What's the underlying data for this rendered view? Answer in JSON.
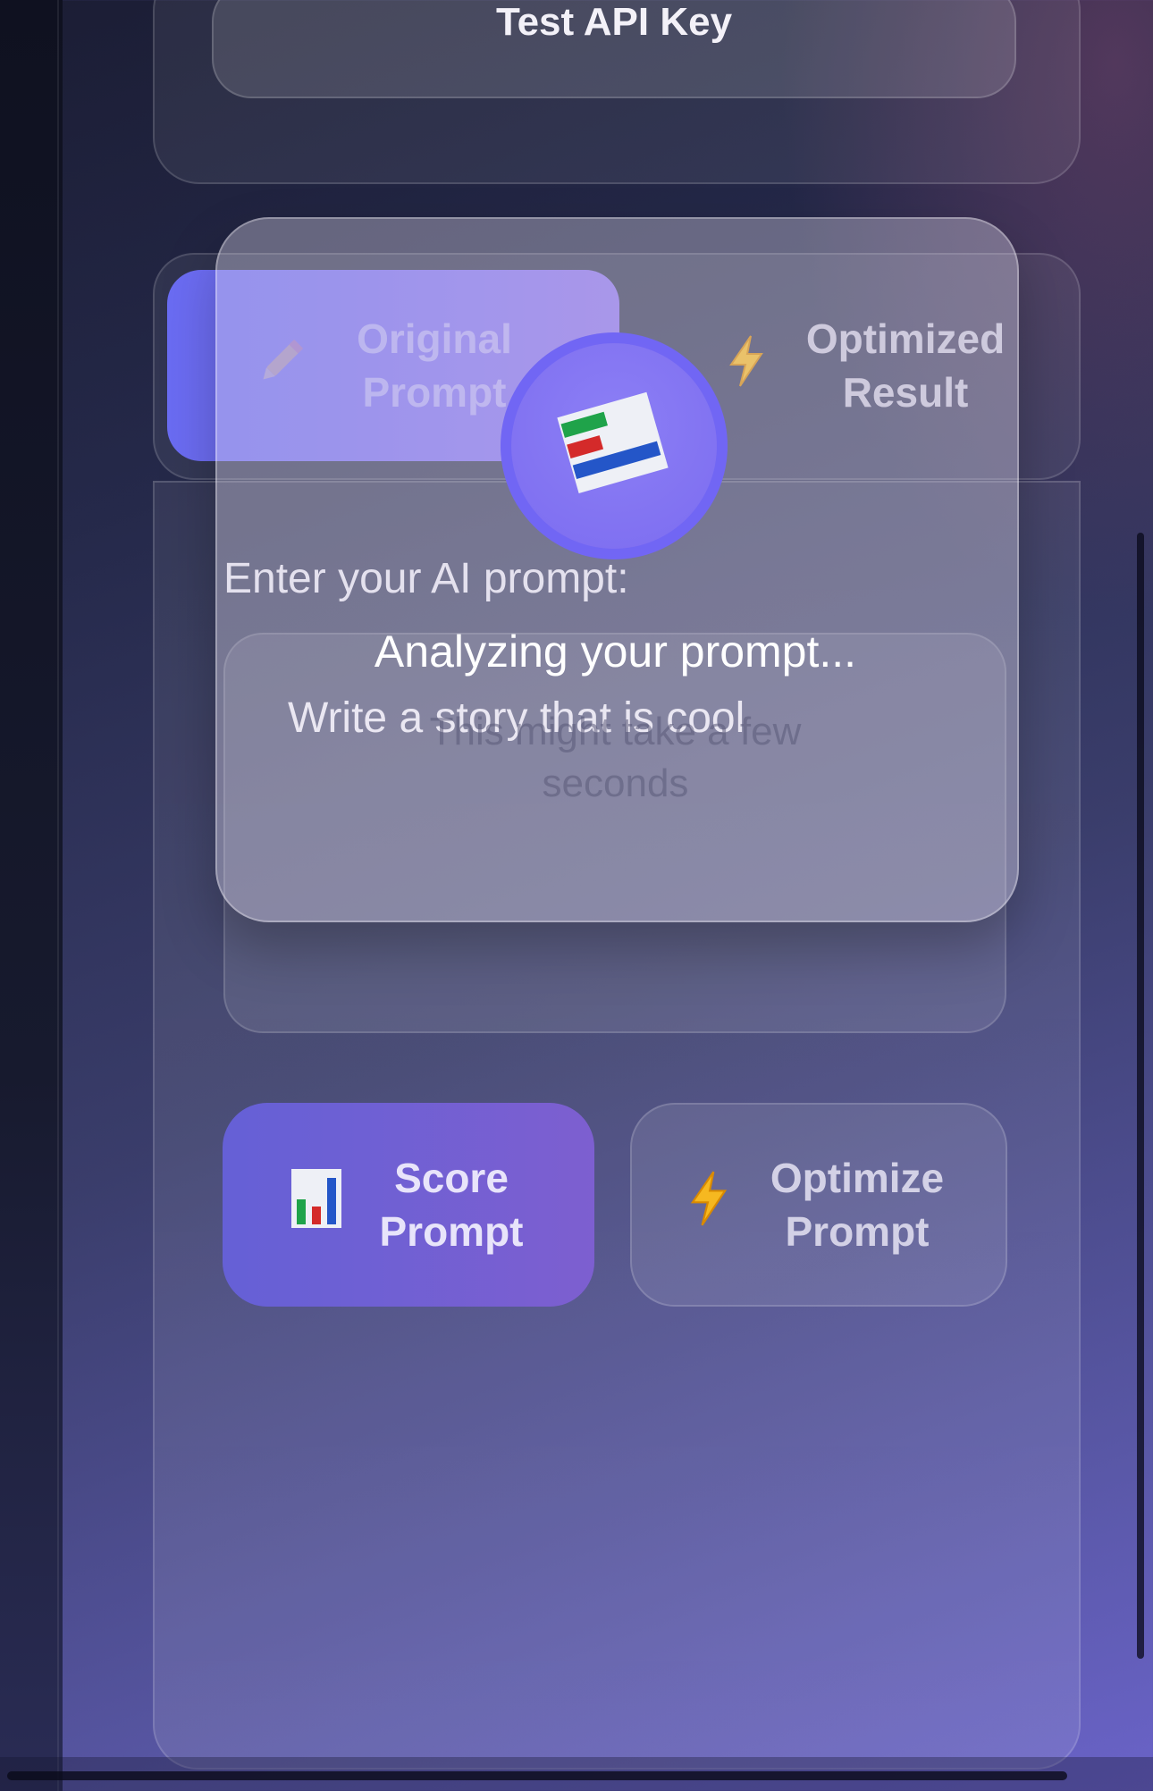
{
  "api": {
    "test_button_label": "Test API Key"
  },
  "tabs": [
    {
      "label": "Original Prompt",
      "icon": "pencil-icon",
      "active": true
    },
    {
      "label": "Optimized Result",
      "icon": "lightning-icon",
      "active": false
    }
  ],
  "editor": {
    "label": "Enter your AI prompt:",
    "value": "Write a story that is cool"
  },
  "actions": {
    "score_label": "Score Prompt",
    "score_icon": "bar-chart-icon",
    "optimize_label": "Optimize Prompt",
    "optimize_icon": "lightning-icon"
  },
  "loading": {
    "title": "Analyzing your prompt...",
    "subtitle": "This might take a few seconds",
    "icon": "bar-chart-icon"
  },
  "colors": {
    "accent": "#6a6cf3",
    "accent_end": "#8d73ee",
    "score_button": "#6560d6"
  }
}
